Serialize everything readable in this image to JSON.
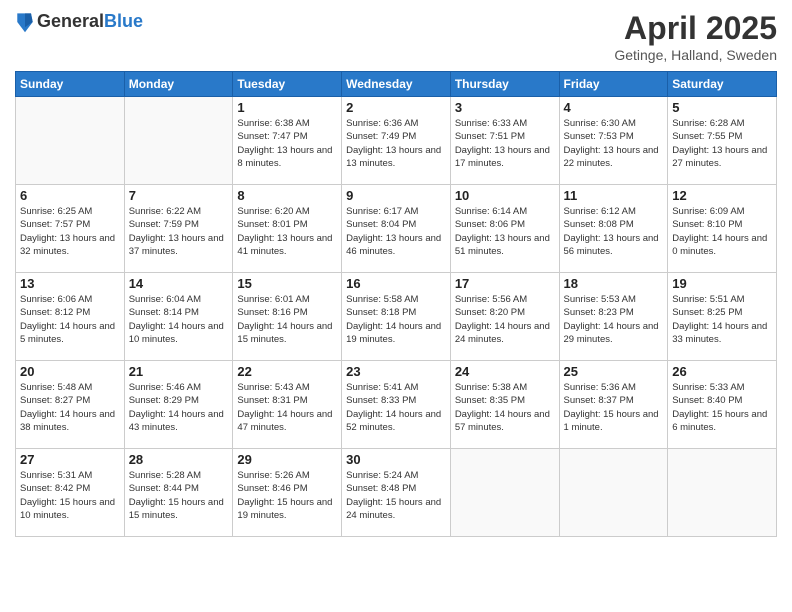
{
  "header": {
    "logo_general": "General",
    "logo_blue": "Blue",
    "title": "April 2025",
    "subtitle": "Getinge, Halland, Sweden"
  },
  "weekdays": [
    "Sunday",
    "Monday",
    "Tuesday",
    "Wednesday",
    "Thursday",
    "Friday",
    "Saturday"
  ],
  "weeks": [
    [
      {
        "day": "",
        "info": ""
      },
      {
        "day": "",
        "info": ""
      },
      {
        "day": "1",
        "info": "Sunrise: 6:38 AM\nSunset: 7:47 PM\nDaylight: 13 hours and 8 minutes."
      },
      {
        "day": "2",
        "info": "Sunrise: 6:36 AM\nSunset: 7:49 PM\nDaylight: 13 hours and 13 minutes."
      },
      {
        "day": "3",
        "info": "Sunrise: 6:33 AM\nSunset: 7:51 PM\nDaylight: 13 hours and 17 minutes."
      },
      {
        "day": "4",
        "info": "Sunrise: 6:30 AM\nSunset: 7:53 PM\nDaylight: 13 hours and 22 minutes."
      },
      {
        "day": "5",
        "info": "Sunrise: 6:28 AM\nSunset: 7:55 PM\nDaylight: 13 hours and 27 minutes."
      }
    ],
    [
      {
        "day": "6",
        "info": "Sunrise: 6:25 AM\nSunset: 7:57 PM\nDaylight: 13 hours and 32 minutes."
      },
      {
        "day": "7",
        "info": "Sunrise: 6:22 AM\nSunset: 7:59 PM\nDaylight: 13 hours and 37 minutes."
      },
      {
        "day": "8",
        "info": "Sunrise: 6:20 AM\nSunset: 8:01 PM\nDaylight: 13 hours and 41 minutes."
      },
      {
        "day": "9",
        "info": "Sunrise: 6:17 AM\nSunset: 8:04 PM\nDaylight: 13 hours and 46 minutes."
      },
      {
        "day": "10",
        "info": "Sunrise: 6:14 AM\nSunset: 8:06 PM\nDaylight: 13 hours and 51 minutes."
      },
      {
        "day": "11",
        "info": "Sunrise: 6:12 AM\nSunset: 8:08 PM\nDaylight: 13 hours and 56 minutes."
      },
      {
        "day": "12",
        "info": "Sunrise: 6:09 AM\nSunset: 8:10 PM\nDaylight: 14 hours and 0 minutes."
      }
    ],
    [
      {
        "day": "13",
        "info": "Sunrise: 6:06 AM\nSunset: 8:12 PM\nDaylight: 14 hours and 5 minutes."
      },
      {
        "day": "14",
        "info": "Sunrise: 6:04 AM\nSunset: 8:14 PM\nDaylight: 14 hours and 10 minutes."
      },
      {
        "day": "15",
        "info": "Sunrise: 6:01 AM\nSunset: 8:16 PM\nDaylight: 14 hours and 15 minutes."
      },
      {
        "day": "16",
        "info": "Sunrise: 5:58 AM\nSunset: 8:18 PM\nDaylight: 14 hours and 19 minutes."
      },
      {
        "day": "17",
        "info": "Sunrise: 5:56 AM\nSunset: 8:20 PM\nDaylight: 14 hours and 24 minutes."
      },
      {
        "day": "18",
        "info": "Sunrise: 5:53 AM\nSunset: 8:23 PM\nDaylight: 14 hours and 29 minutes."
      },
      {
        "day": "19",
        "info": "Sunrise: 5:51 AM\nSunset: 8:25 PM\nDaylight: 14 hours and 33 minutes."
      }
    ],
    [
      {
        "day": "20",
        "info": "Sunrise: 5:48 AM\nSunset: 8:27 PM\nDaylight: 14 hours and 38 minutes."
      },
      {
        "day": "21",
        "info": "Sunrise: 5:46 AM\nSunset: 8:29 PM\nDaylight: 14 hours and 43 minutes."
      },
      {
        "day": "22",
        "info": "Sunrise: 5:43 AM\nSunset: 8:31 PM\nDaylight: 14 hours and 47 minutes."
      },
      {
        "day": "23",
        "info": "Sunrise: 5:41 AM\nSunset: 8:33 PM\nDaylight: 14 hours and 52 minutes."
      },
      {
        "day": "24",
        "info": "Sunrise: 5:38 AM\nSunset: 8:35 PM\nDaylight: 14 hours and 57 minutes."
      },
      {
        "day": "25",
        "info": "Sunrise: 5:36 AM\nSunset: 8:37 PM\nDaylight: 15 hours and 1 minute."
      },
      {
        "day": "26",
        "info": "Sunrise: 5:33 AM\nSunset: 8:40 PM\nDaylight: 15 hours and 6 minutes."
      }
    ],
    [
      {
        "day": "27",
        "info": "Sunrise: 5:31 AM\nSunset: 8:42 PM\nDaylight: 15 hours and 10 minutes."
      },
      {
        "day": "28",
        "info": "Sunrise: 5:28 AM\nSunset: 8:44 PM\nDaylight: 15 hours and 15 minutes."
      },
      {
        "day": "29",
        "info": "Sunrise: 5:26 AM\nSunset: 8:46 PM\nDaylight: 15 hours and 19 minutes."
      },
      {
        "day": "30",
        "info": "Sunrise: 5:24 AM\nSunset: 8:48 PM\nDaylight: 15 hours and 24 minutes."
      },
      {
        "day": "",
        "info": ""
      },
      {
        "day": "",
        "info": ""
      },
      {
        "day": "",
        "info": ""
      }
    ]
  ]
}
